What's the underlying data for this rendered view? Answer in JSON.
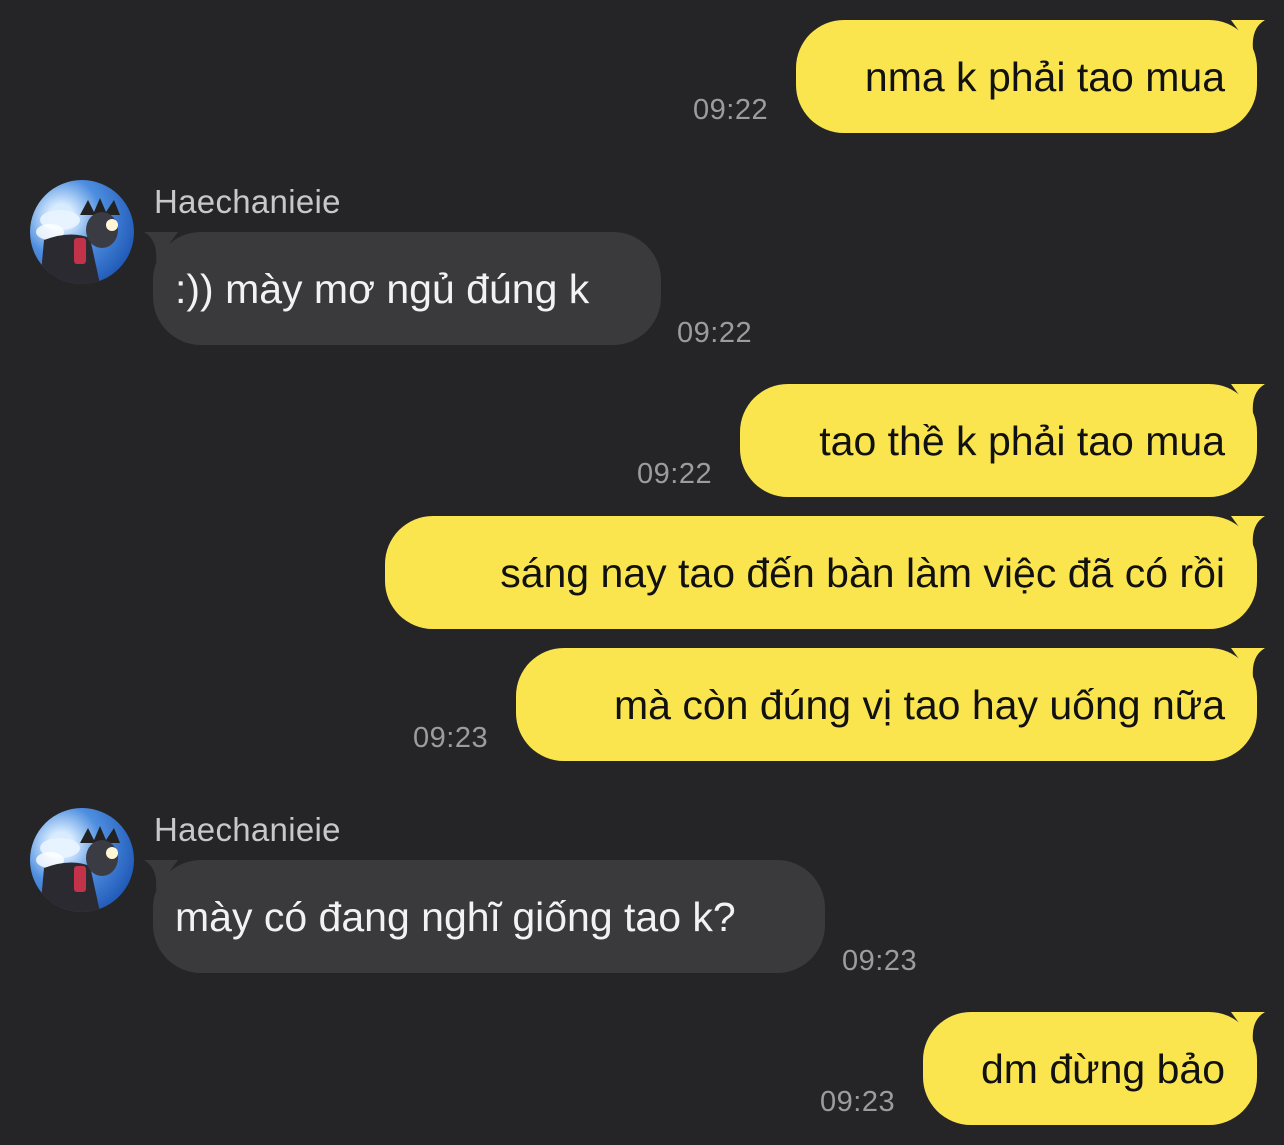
{
  "contact": {
    "name": "Haechanieie",
    "avatar_icon": "profile-photo-avatar"
  },
  "colors": {
    "background": "#252527",
    "outgoing_bubble": "#fbe54e",
    "incoming_bubble": "#3a3a3c",
    "timestamp": "#9c9ca0"
  },
  "messages": [
    {
      "direction": "out",
      "text": "nma k phải tao mua",
      "time": "09:22"
    },
    {
      "direction": "in",
      "sender": "Haechanieie",
      "text": ":)) mày mơ ngủ đúng k",
      "time": "09:22"
    },
    {
      "direction": "out",
      "text": "tao thề k phải tao mua",
      "time": "09:22"
    },
    {
      "direction": "out",
      "text": "sáng nay tao đến bàn làm việc đã có rồi",
      "time": ""
    },
    {
      "direction": "out",
      "text": "mà còn đúng vị tao hay uống nữa",
      "time": "09:23"
    },
    {
      "direction": "in",
      "sender": "Haechanieie",
      "text": "mày có đang nghĩ giống tao k?",
      "time": "09:23"
    },
    {
      "direction": "out",
      "text": "dm đừng bảo",
      "time": "09:23"
    }
  ]
}
